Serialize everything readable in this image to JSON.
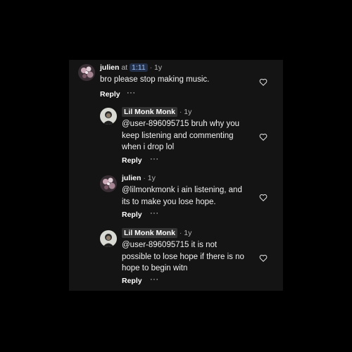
{
  "comments": [
    {
      "author": "julien",
      "at_label": "at",
      "timestamp": "1:11",
      "separator": "·",
      "age": "1y",
      "lines": [
        "bro please stop making music."
      ],
      "reply_label": "Reply",
      "more_label": "···"
    },
    {
      "author": "Lil Monk Monk",
      "separator": "·",
      "age": "1y",
      "lines": [
        "@user-896095715 bruh why you",
        "keep listening and commenting",
        "when i drop lol"
      ],
      "reply_label": "Reply",
      "more_label": "···"
    },
    {
      "author": "julien",
      "separator": "·",
      "age": "1y",
      "lines": [
        "@lilmonkmonk i ain listening, and",
        "its to make you lose hope."
      ],
      "reply_label": "Reply",
      "more_label": "···"
    },
    {
      "author": "Lil Monk Monk",
      "separator": "·",
      "age": "1y",
      "lines": [
        "@user-896095715 it is not",
        "possible to lose hope if there is no",
        "hope to begin witn"
      ],
      "reply_label": "Reply",
      "more_label": "···"
    }
  ],
  "icons": {
    "like": "heart-outline-icon",
    "avatar_julien": "floral-avatar",
    "avatar_monk": "portrait-avatar"
  },
  "colors": {
    "background": "#000000",
    "panel": "#141414",
    "timestamp_chip": "#22304a",
    "timestamp_text": "#9fc0f2"
  }
}
